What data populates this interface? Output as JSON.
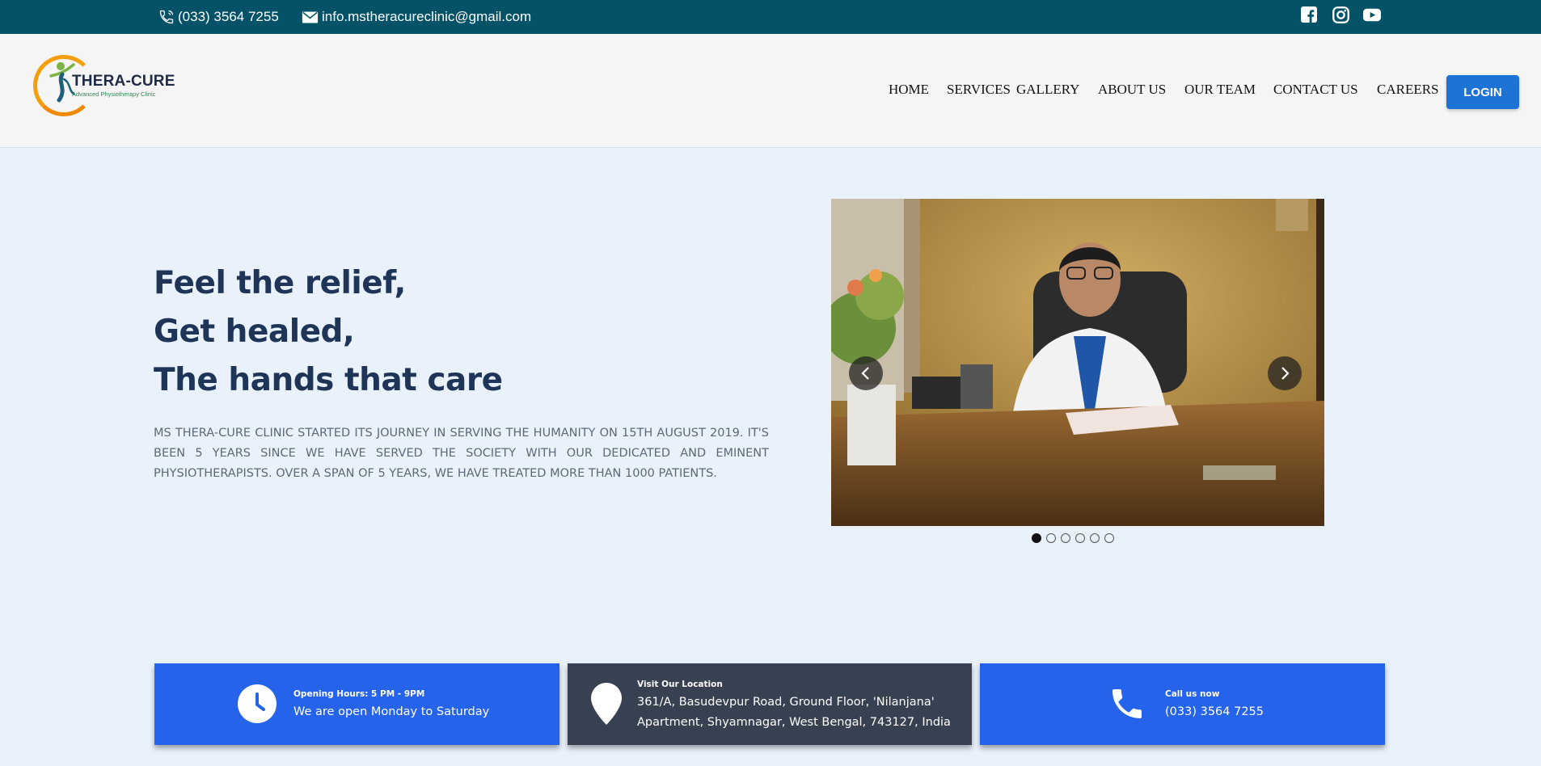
{
  "topbar": {
    "phone": "(033) 3564 7255",
    "email": "info.mstheracureclinic@gmail.com",
    "social": [
      {
        "icon": "facebook-icon"
      },
      {
        "icon": "instagram-icon"
      },
      {
        "icon": "youtube-icon"
      }
    ]
  },
  "logo": {
    "name": "THERA-CURE",
    "tagline": "Advanced Physiotherapy Clinic"
  },
  "nav": {
    "items": [
      "HOME",
      "SERVICES",
      "GALLERY",
      "ABOUT US",
      "OUR TEAM",
      "CONTACT US",
      "CAREERS"
    ],
    "login_label": "LOGIN"
  },
  "hero": {
    "headline_lines": [
      "Feel the relief,",
      "Get healed,",
      "The hands that care"
    ],
    "intro": "MS THERA-CURE CLINIC STARTED ITS JOURNEY IN SERVING THE HUMANITY ON 15TH AUGUST 2019. IT'S BEEN 5 YEARS SINCE WE HAVE SERVED THE SOCIETY WITH OUR DEDICATED AND EMINENT PHYSIOTHERAPISTS. OVER A SPAN OF 5 YEARS, WE HAVE TREATED MORE THAN 1000 PATIENTS."
  },
  "slider": {
    "slide_count": 6,
    "active_index": 0
  },
  "cards": [
    {
      "icon": "clock-icon",
      "title": "Opening Hours: 5 PM - 9PM",
      "lines": [
        "We are open Monday to Saturday"
      ],
      "color": "#2563eb"
    },
    {
      "icon": "location-pin-icon",
      "title": "Visit Our Location",
      "lines": [
        "361/A, Basudevpur Road, Ground Floor, 'Nilanjana'",
        "Apartment, Shyamnagar, West Bengal, 743127, India"
      ],
      "color": "#384152"
    },
    {
      "icon": "phone-icon",
      "title": "Call us now",
      "lines": [
        "(033) 3564 7255"
      ],
      "color": "#2563eb"
    }
  ],
  "colors": {
    "topbar": "#035267",
    "accent": "#1d72d6",
    "headline": "#1e3557",
    "page_bg": "#e9f1fb"
  }
}
